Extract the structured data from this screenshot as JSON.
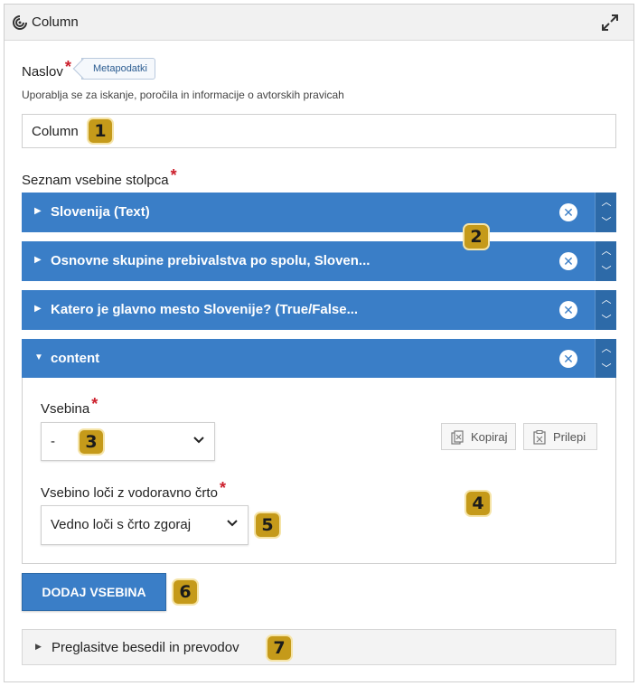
{
  "header": {
    "title": "Column",
    "app_icon": "hp5-column-icon",
    "expand_icon": "fullscreen-expand-icon"
  },
  "title_field": {
    "label": "Naslov",
    "required_mark": "*",
    "tag": "Metapodatki",
    "hint": "Uporablja se za iskanje, poročila in informacije o avtorskih pravicah",
    "value": "Column"
  },
  "content_list": {
    "label": "Seznam vsebine stolpca",
    "required_mark": "*",
    "items": [
      {
        "title": "Slovenija (Text)",
        "expanded": false
      },
      {
        "title": "Osnovne skupine prebivalstva po spolu, Sloven...",
        "expanded": false
      },
      {
        "title": "Katero je glavno mesto Slovenije? (True/False...",
        "expanded": false
      },
      {
        "title": "content",
        "expanded": true
      }
    ]
  },
  "content_item": {
    "content_label": "Vsebina",
    "content_value": "-",
    "copy_label": "Kopiraj",
    "paste_label": "Prilepi",
    "separator_label": "Vsebino loči z vodoravno črto",
    "separator_value": "Vedno loči s črto zgoraj",
    "required_mark": "*"
  },
  "add_button": {
    "label": "DODAJ VSEBINA"
  },
  "accordion": {
    "label": "Preglasitve besedil in prevodov"
  },
  "badges": [
    "1",
    "2",
    "3",
    "4",
    "5",
    "6",
    "7"
  ],
  "colors": {
    "accent": "#3a7ec7",
    "accent_dark": "#2d6aa8",
    "required": "#cc1f2c",
    "badge": "#c59a1a"
  }
}
